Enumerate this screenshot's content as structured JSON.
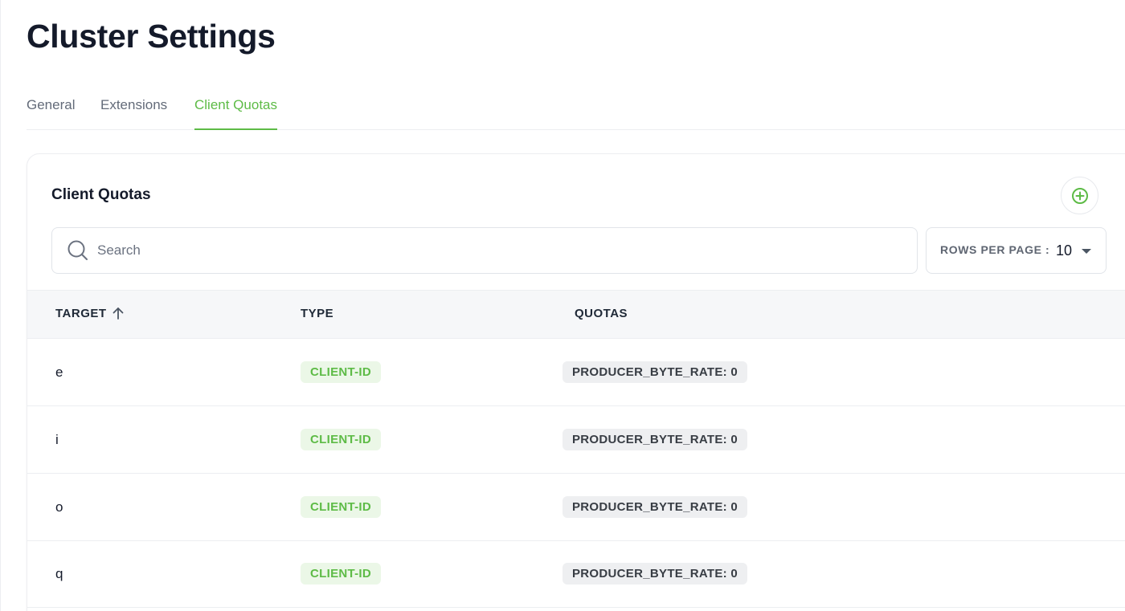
{
  "page": {
    "title": "Cluster Settings"
  },
  "tabs": [
    {
      "label": "General",
      "active": false
    },
    {
      "label": "Extensions",
      "active": false
    },
    {
      "label": "Client Quotas",
      "active": true
    }
  ],
  "card": {
    "title": "Client Quotas",
    "add_icon": "plus-circle-icon",
    "search": {
      "placeholder": "Search",
      "value": ""
    },
    "rows_per_page": {
      "label": "ROWS PER PAGE :",
      "value": "10"
    }
  },
  "table": {
    "headers": {
      "target": "TARGET",
      "type": "TYPE",
      "quotas": "QUOTAS"
    },
    "sort": {
      "column": "TARGET",
      "direction": "ascending",
      "icon": "arrow-up-icon"
    },
    "rows": [
      {
        "target": "e",
        "type": "CLIENT-ID",
        "quotas": "PRODUCER_BYTE_RATE: 0"
      },
      {
        "target": "i",
        "type": "CLIENT-ID",
        "quotas": "PRODUCER_BYTE_RATE: 0"
      },
      {
        "target": "o",
        "type": "CLIENT-ID",
        "quotas": "PRODUCER_BYTE_RATE: 0"
      },
      {
        "target": "q",
        "type": "CLIENT-ID",
        "quotas": "PRODUCER_BYTE_RATE: 0"
      }
    ]
  },
  "colors": {
    "accent": "#5dbb46",
    "accent_bg": "#ebf7e7",
    "quota_bg": "#eeeff1"
  }
}
